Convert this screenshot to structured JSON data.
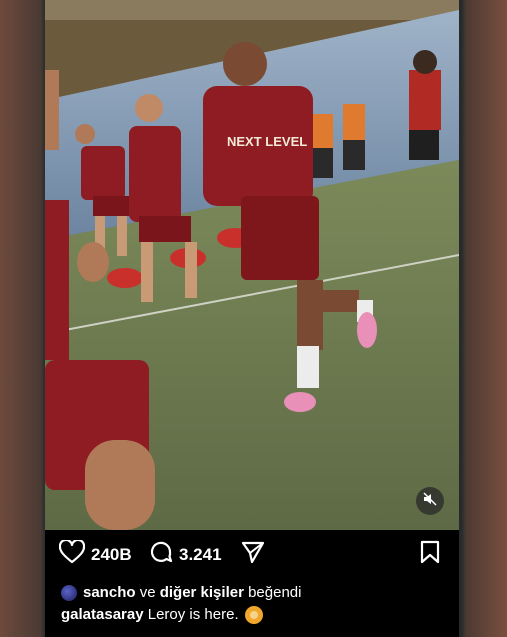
{
  "post": {
    "media": {
      "type": "video",
      "sound_icon": "speaker-muted-icon",
      "shirt_text": "NEXT LEVEL"
    },
    "actions": {
      "like_icon": "heart-icon",
      "like_count": "240B",
      "comment_icon": "comment-icon",
      "comment_count": "3.241",
      "share_icon": "send-icon",
      "save_icon": "bookmark-icon"
    },
    "liked_by": {
      "user": "sancho",
      "connector": "ve",
      "others": "diğer kişiler",
      "suffix": "beğendi"
    },
    "caption": {
      "username": "galatasaray",
      "text": "Leroy is here.",
      "emoji_icon": "lion-emoji-icon"
    }
  },
  "colors": {
    "kit_red": "#8e1c22",
    "pitch_green": "#6f7d54",
    "staff_orange": "#e07a2e",
    "background": "#000000",
    "text": "#ffffff"
  }
}
